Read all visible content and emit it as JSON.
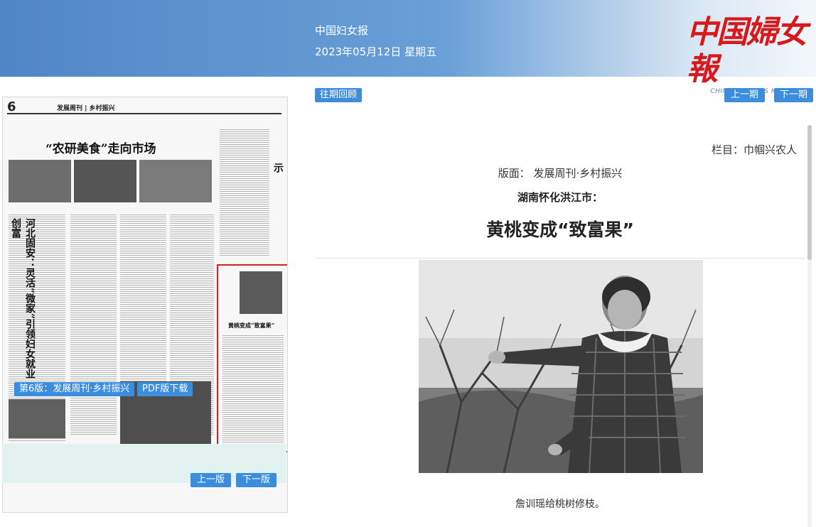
{
  "header": {
    "paper_name": "中国妇女报",
    "date": "2023年05月12日 星期五",
    "logo_cn": "中国婦女報",
    "logo_en": "CHINA WOMEN'S NEWS"
  },
  "left": {
    "thumb": {
      "page_num": "6",
      "section": "发展周刊 | 乡村振兴",
      "headline": "“农研美食”走向市场",
      "vertical_title_1": "科技小院带来的三点启示",
      "vertical_title_2": "河北固安：灵活“微家”引领妇女就业创富",
      "highlight_title": "黄桃变成“致富果”"
    },
    "section_button": "第6版：发展周刊·乡村振兴",
    "pdf_button": "PDF版下载",
    "prev_page": "上一版",
    "next_page": "下一版"
  },
  "nav": {
    "archive": "往期回顾",
    "prev": "上一期",
    "next": "下一期"
  },
  "article": {
    "column": "栏目：巾帼兴农人",
    "banmian": "版面：  发展周刊·乡村振兴",
    "subhead": "湖南怀化洪江市：",
    "headline": "黄桃变成“致富果”",
    "caption": "詹训瑶给桃树修枝。"
  }
}
